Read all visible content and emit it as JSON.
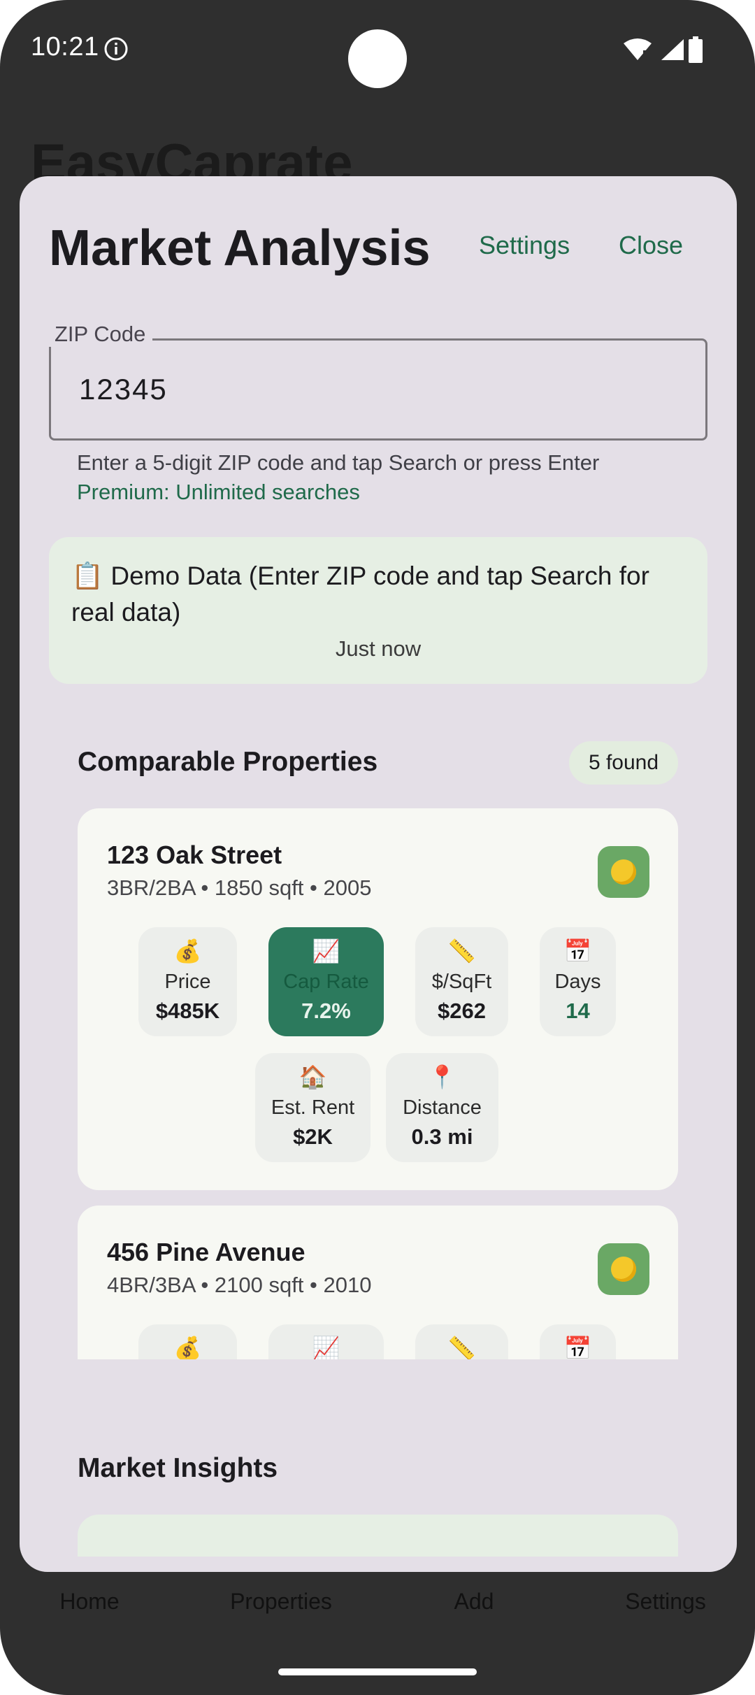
{
  "status_bar": {
    "time": "10:21"
  },
  "background_app": {
    "title": "EasyCaprate",
    "nav": [
      "Home",
      "Properties",
      "Add",
      "Settings"
    ]
  },
  "dialog": {
    "title": "Market Analysis",
    "settings_label": "Settings",
    "close_label": "Close",
    "zip_field": {
      "label": "ZIP Code",
      "value": "12345"
    },
    "helper_text": "Enter a 5-digit ZIP code and tap Search or press Enter",
    "premium_text": "Premium: Unlimited searches",
    "demo_banner": {
      "text": "📋 Demo Data (Enter ZIP code and tap Search for real data)",
      "time": "Just now"
    },
    "comparables": {
      "title": "Comparable Properties",
      "badge": "5 found",
      "properties": [
        {
          "address": "123 Oak Street",
          "details": "3BR/2BA • 1850 sqft • 2005",
          "status_icon": "yellow-circle",
          "metrics": [
            {
              "icon": "💰",
              "label": "Price",
              "value": "$485K"
            },
            {
              "icon": "📈",
              "label": "Cap Rate",
              "value": "7.2%"
            },
            {
              "icon": "📏",
              "label": "$/SqFt",
              "value": "$262"
            },
            {
              "icon": "📅",
              "label": "Days",
              "value": "14"
            },
            {
              "icon": "🏠",
              "label": "Est. Rent",
              "value": "$2K"
            },
            {
              "icon": "📍",
              "label": "Distance",
              "value": "0.3 mi"
            }
          ]
        },
        {
          "address": "456 Pine Avenue",
          "details": "4BR/3BA • 2100 sqft • 2010",
          "status_icon": "yellow-circle",
          "metrics": [
            {
              "icon": "💰"
            },
            {
              "icon": "📈"
            },
            {
              "icon": "📏"
            },
            {
              "icon": "📅"
            }
          ]
        }
      ]
    },
    "insights": {
      "title": "Market Insights"
    }
  },
  "colors": {
    "accent": "#1f6a4a",
    "highlight": "#2c7a5d",
    "dialog_bg": "#e4dfe7"
  }
}
